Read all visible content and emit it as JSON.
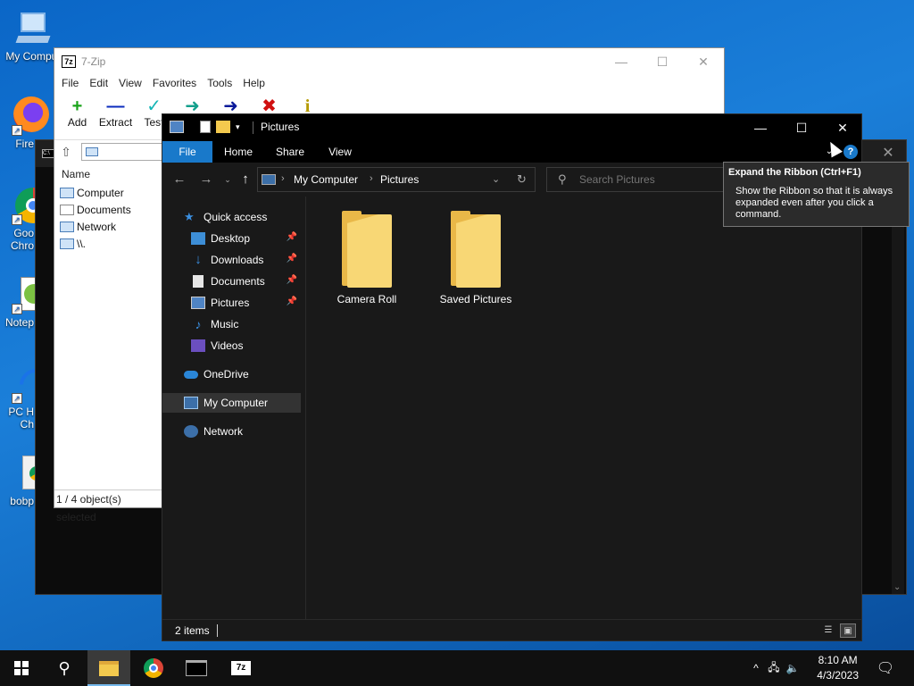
{
  "desktop": {
    "icons": [
      {
        "label": "My Comput",
        "icon": "computer-icon"
      },
      {
        "label": "Fire",
        "icon": "firefox-icon"
      },
      {
        "label": "Goo",
        "label2": "Chro",
        "icon": "chrome-icon"
      },
      {
        "label": "Notep",
        "icon": "notepad-icon"
      },
      {
        "label": "PC H",
        "label2": "Ch",
        "icon": "pc-health-icon"
      },
      {
        "label": "bobp",
        "icon": "document-icon"
      }
    ]
  },
  "zip": {
    "title": "7-Zip",
    "logo": "7z",
    "menu": [
      "File",
      "Edit",
      "View",
      "Favorites",
      "Tools",
      "Help"
    ],
    "tools": [
      {
        "label": "Add",
        "glyph": "+",
        "color": "#19a319"
      },
      {
        "label": "Extract",
        "glyph": "—",
        "color": "#0a2bbd"
      },
      {
        "label": "Test",
        "glyph": "✓",
        "color": "#14b5b5"
      },
      {
        "label": "",
        "glyph": "➜",
        "color": "#14a08c"
      },
      {
        "label": "",
        "glyph": "➜",
        "color": "#0a1a9a"
      },
      {
        "label": "",
        "glyph": "✖",
        "color": "#d01010"
      },
      {
        "label": "",
        "glyph": "i",
        "color": "#b59a00"
      }
    ],
    "list_header": "Name",
    "rows": [
      "Computer",
      "Documents",
      "Network",
      "\\\\."
    ],
    "status": "1 / 4 object(s) selected"
  },
  "explorer": {
    "title": "Pictures",
    "tabs": [
      "File",
      "Home",
      "Share",
      "View"
    ],
    "breadcrumb": [
      "My Computer",
      "Pictures"
    ],
    "search_placeholder": "Search Pictures",
    "nav": {
      "quick_access": "Quick access",
      "items": [
        {
          "label": "Desktop",
          "icon": "desktop-icon",
          "pinned": true
        },
        {
          "label": "Downloads",
          "icon": "downloads-icon",
          "pinned": true
        },
        {
          "label": "Documents",
          "icon": "documents-icon",
          "pinned": true
        },
        {
          "label": "Pictures",
          "icon": "pictures-icon",
          "pinned": true
        },
        {
          "label": "Music",
          "icon": "music-icon",
          "pinned": false
        },
        {
          "label": "Videos",
          "icon": "videos-icon",
          "pinned": false
        }
      ],
      "onedrive": "OneDrive",
      "my_computer": "My Computer",
      "network": "Network"
    },
    "folders": [
      "Camera Roll",
      "Saved Pictures"
    ],
    "status_count": "2 items"
  },
  "tooltip": {
    "title": "Expand the Ribbon (Ctrl+F1)",
    "body": "Show the Ribbon so that it is always expanded even after you click a command."
  },
  "taskbar": {
    "time": "8:10 AM",
    "date": "4/3/2023"
  }
}
